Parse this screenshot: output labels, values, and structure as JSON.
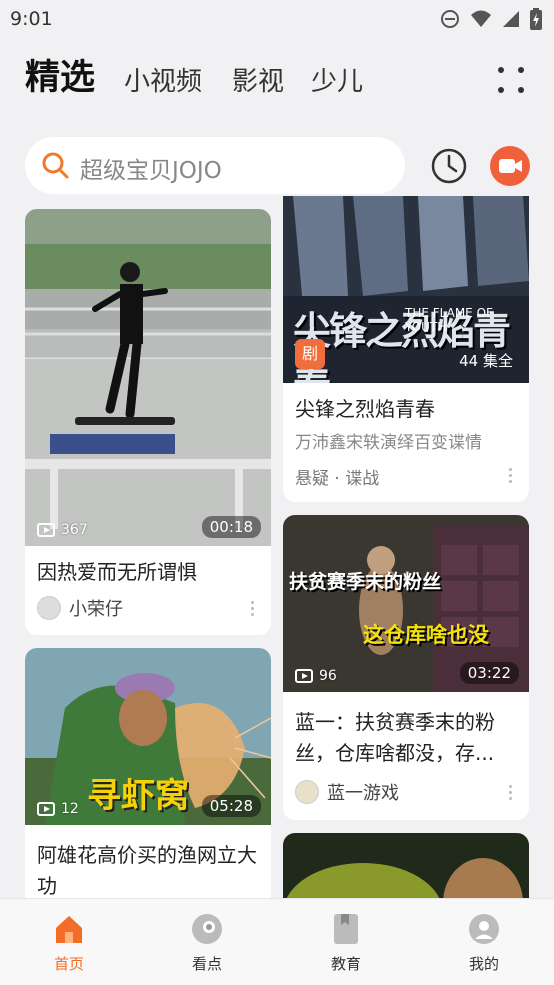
{
  "status": {
    "time": "9:01"
  },
  "tabs": [
    {
      "label": "精选"
    },
    {
      "label": "小视频"
    },
    {
      "label": "影视"
    },
    {
      "label": "少儿"
    }
  ],
  "search": {
    "placeholder": "超级宝贝JOJO"
  },
  "feed": {
    "left": [
      {
        "views": "367",
        "duration": "00:18",
        "title": "因热爱而无所谓惧",
        "author": "小荣仔"
      },
      {
        "views": "12",
        "duration": "05:28",
        "title": "阿雄花高价买的渔网立大功",
        "overlay_text": "寻虾窝"
      }
    ],
    "right": [
      {
        "badge": "剧",
        "episodes": "44 集全",
        "poster_title": "尖锋之烈焰青春",
        "poster_sub": "THE FLAME OF YOUTH",
        "title": "尖锋之烈焰青春",
        "subtitle": "万沛鑫宋轶演绎百变谍情",
        "tags": "悬疑 · 谍战"
      },
      {
        "views": "96",
        "duration": "03:22",
        "overlay_line1": "扶贫赛季末的粉丝",
        "overlay_line2": "这仓库啥也没",
        "title": "蓝一：扶贫赛季末的粉丝，仓库啥都没，存...",
        "author": "蓝一游戏"
      }
    ]
  },
  "bottom_nav": [
    {
      "label": "首页",
      "active": true
    },
    {
      "label": "看点",
      "active": false
    },
    {
      "label": "教育",
      "active": false
    },
    {
      "label": "我的",
      "active": false
    }
  ],
  "colors": {
    "accent": "#f36d2a",
    "camera": "#f0603a"
  }
}
